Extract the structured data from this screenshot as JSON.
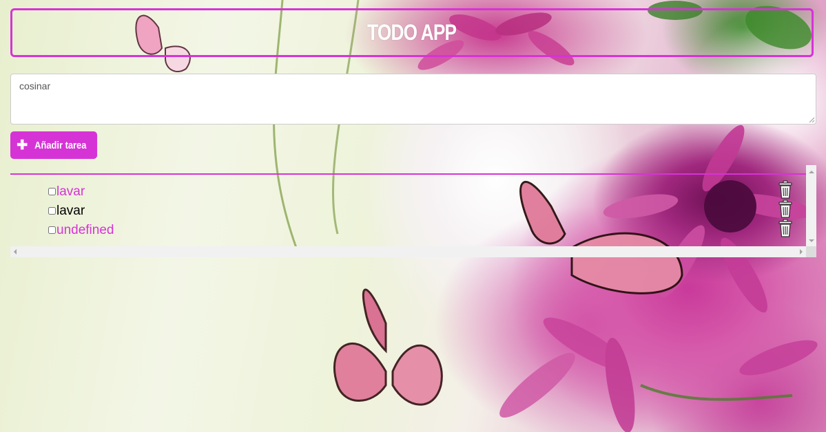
{
  "app": {
    "title": "TODO APP"
  },
  "input": {
    "value": "cosinar"
  },
  "add_button": {
    "icon": "plus-icon",
    "label": "Añadir tarea"
  },
  "colors": {
    "accent": "#d633d6",
    "done_text": "#d633d6",
    "pending_text": "#000000",
    "title_text": "#ffffff"
  },
  "tasks": [
    {
      "label": "lavar",
      "checked": false,
      "style": "pink"
    },
    {
      "label": "lavar",
      "checked": false,
      "style": "black"
    },
    {
      "label": "undefined",
      "checked": false,
      "style": "pink"
    }
  ]
}
